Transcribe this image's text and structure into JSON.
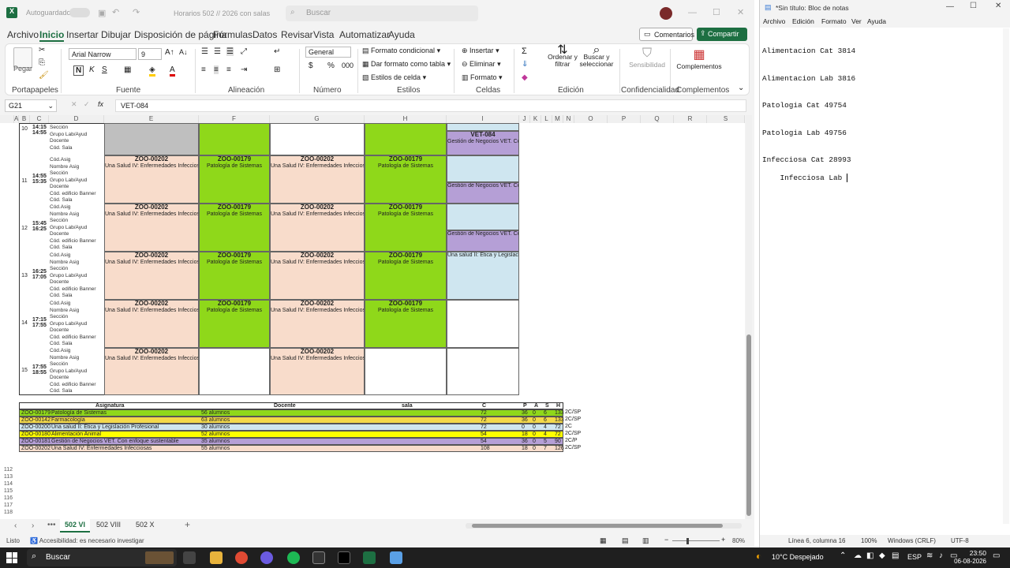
{
  "excel": {
    "autosave_label": "Autoguardado",
    "doc_title": "Horarios 502 // 2026 con salas",
    "search_placeholder": "Buscar",
    "menu_tabs": [
      "Archivo",
      "Inicio",
      "Insertar",
      "Dibujar",
      "Disposición de página",
      "Fórmulas",
      "Datos",
      "Revisar",
      "Vista",
      "Automatizar",
      "Ayuda"
    ],
    "comments_label": "Comentarios",
    "share_label": "Compartir",
    "ribbon": {
      "paste_label": "Pegar",
      "font_name": "Arial Narrow",
      "font_size": "9",
      "number_format": "General",
      "cond_format": "Formato condicional",
      "format_table": "Dar formato como tabla",
      "cell_styles": "Estilos de celda",
      "insert": "Insertar",
      "delete": "Eliminar",
      "format": "Formato",
      "sort_filter": "Ordenar y filtrar",
      "find_select": "Buscar y seleccionar",
      "sensitivity": "Sensibilidad",
      "addins": "Complementos",
      "groups": [
        "Portapapeles",
        "Fuente",
        "Alineación",
        "Número",
        "Estilos",
        "Celdas",
        "Edición",
        "Confidencialidad",
        "Complementos"
      ]
    },
    "name_box": "G21",
    "formula": "VET-084",
    "columns": [
      "A",
      "B",
      "C",
      "D",
      "E",
      "F",
      "G",
      "H",
      "I",
      "J",
      "K",
      "L",
      "M",
      "N",
      "O",
      "P",
      "Q",
      "R",
      "S"
    ],
    "row_labels": [
      "Cód.Asig",
      "Nombre Asig",
      "Sección",
      "Grupo Lab/Ayud",
      "Docente",
      "Cód. edificio Banner",
      "Cód. Sala"
    ],
    "blocks": [
      {
        "num": "10",
        "time": "14:15\n14:55",
        "rows": "64–68"
      },
      {
        "num": "11",
        "time": "14:55\n15:35",
        "rows": "69–75"
      },
      {
        "num": "12",
        "time": "15:45\n16:25",
        "rows": "76–82"
      },
      {
        "num": "13",
        "time": "16:25\n17:05",
        "rows": "83–89"
      },
      {
        "num": "14",
        "time": "17:15\n17:55",
        "rows": "90–96"
      },
      {
        "num": "15",
        "time": "17:55\n18:55",
        "rows": "97–103"
      }
    ],
    "summary_headers": {
      "asig": "Asignatura",
      "docente": "Docente",
      "sala": "sala",
      "c": "C",
      "p": "P",
      "a": "A",
      "s": "S",
      "h": "H"
    },
    "summary": [
      {
        "code": "ZOO-00179",
        "name": "Patología de Sistemas",
        "alumnos": "56 alumnos",
        "c": "72",
        "p": "36",
        "a": "0",
        "s": "6",
        "h": "133",
        "sem": "2C/SP",
        "color": "#8fd81a"
      },
      {
        "code": "ZOO-00142",
        "name": "Farmacología",
        "alumnos": "63 alumnos",
        "c": "72",
        "p": "36",
        "a": "0",
        "s": "6",
        "h": "133",
        "sem": "2C/SP",
        "color": "#f4d94a"
      },
      {
        "code": "ZOO-00200",
        "name": "Una salud II: Ética y Legislación Profesional",
        "alumnos": "30 alumnos",
        "c": "72",
        "p": "0",
        "a": "0",
        "s": "4",
        "h": "72",
        "sem": "2C",
        "color": "#cfe6f0"
      },
      {
        "code": "ZOO-00180",
        "name": "Alimentación Animal",
        "alumnos": "52 alumnos",
        "c": "54",
        "p": "18",
        "a": "0",
        "s": "4",
        "h": "72",
        "sem": "2C/SP",
        "color": "#ffff00"
      },
      {
        "code": "ZOO-00181",
        "name": "Gestión de Negocios VET. Con enfoque sustentable",
        "alumnos": "35 alumnos",
        "c": "54",
        "p": "36",
        "a": "0",
        "s": "5",
        "h": "90",
        "sem": "2C/P",
        "color": "#b59fd6"
      },
      {
        "code": "ZOO-00202",
        "name": "Una Salud IV: Enfermedades Infecciosas",
        "alumnos": "55 alumnos",
        "c": "108",
        "p": "18",
        "a": "0",
        "s": "7",
        "h": "126",
        "sem": "2C/SP",
        "color": "#f8dccb"
      }
    ],
    "sheet_tabs": [
      "502 VI",
      "502 VIII",
      "502 X"
    ],
    "status_left": "Listo",
    "accessibility": "Accesibilidad: es necesario investigar",
    "zoom": "80%"
  },
  "notepad": {
    "title": "*Sin título: Bloc de notas",
    "menu": [
      "Archivo",
      "Edición",
      "Formato",
      "Ver",
      "Ayuda"
    ],
    "lines": [
      "Alimentacion Cat 3814",
      "Alimentacion Lab 3816",
      "Patologia Cat 49754",
      "Patologia Lab 49756",
      "Infecciosa Cat 28993",
      "Infecciosa Lab "
    ],
    "status": {
      "pos": "Línea 6, columna 16",
      "zoom": "100%",
      "eol": "Windows (CRLF)",
      "enc": "UTF-8"
    }
  },
  "taskbar": {
    "search": "Buscar",
    "weather": "10°C Despejado",
    "lang": "ESP",
    "time": "23:50",
    "date": "06-08-2026"
  }
}
